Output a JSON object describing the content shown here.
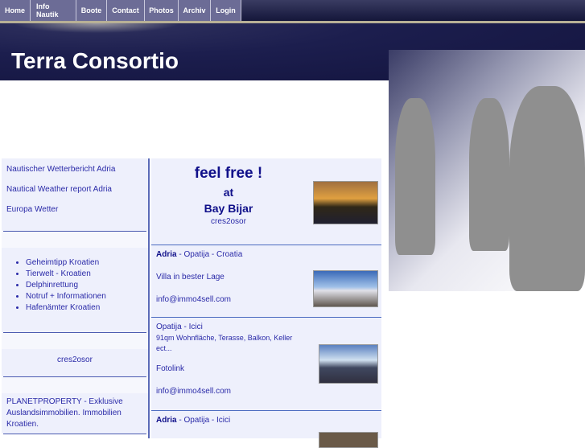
{
  "nav": [
    "Home",
    "Info Nautik",
    "Boote",
    "Contact",
    "Photos",
    "Archiv",
    "Login"
  ],
  "header": {
    "title": "Terra Consortio"
  },
  "left": {
    "links": [
      "Nautischer Wetterbericht Adria",
      "Nautical Weather report Adria",
      "Europa Wetter"
    ],
    "list": [
      "Geheimtipp Kroatien",
      "Tierwelt - Kroatien",
      "Delphinrettung",
      "Notruf + Informationen",
      "Hafenämter Kroatien"
    ],
    "center": "cres2osor",
    "planet": "PLANETPROPERTY - Exklusive Auslandsimmobilien. Immobilien Kroatien."
  },
  "main": {
    "promo": {
      "line1": "feel  free !",
      "line2": "at",
      "line3": "Bay Bijar",
      "line4": "cres2osor"
    },
    "listing1": {
      "region": "Adria",
      "loc": " - Opatija - Croatia",
      "desc": "Villa in bester Lage",
      "email": "info@immo4sell.com"
    },
    "listing2": {
      "loc": "Opatija - Icici",
      "desc": "91qm Wohnfläche, Terasse, Balkon, Keller ect...",
      "link": "Fotolink",
      "email": "info@immo4sell.com"
    },
    "listing3": {
      "region": "Adria",
      "loc": " - Opatija - Icici"
    }
  }
}
